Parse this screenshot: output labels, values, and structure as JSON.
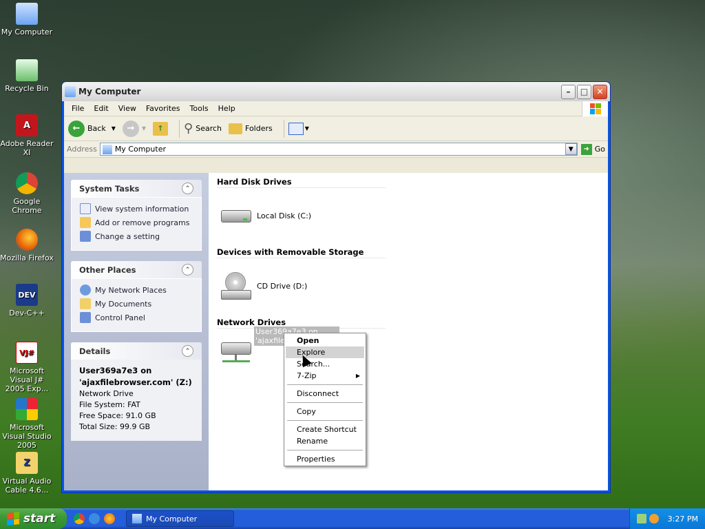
{
  "desktop": {
    "icons": [
      {
        "label": "My Computer"
      },
      {
        "label": "Recycle Bin"
      },
      {
        "label": "Adobe Reader XI"
      },
      {
        "label": "Google Chrome"
      },
      {
        "label": "Mozilla Firefox"
      },
      {
        "label": "Dev-C++",
        "glyph": "DEV"
      },
      {
        "label": "Microsoft Visual J# 2005 Exp...",
        "glyph": "VJ#"
      },
      {
        "label": "Microsoft Visual Studio 2005"
      },
      {
        "label": "Virtual Audio Cable 4.6...",
        "glyph": "Z"
      }
    ]
  },
  "window": {
    "title": "My Computer",
    "menu": [
      "File",
      "Edit",
      "View",
      "Favorites",
      "Tools",
      "Help"
    ],
    "toolbar": {
      "back": "Back",
      "search": "Search",
      "folders": "Folders"
    },
    "address": {
      "label": "Address",
      "value": "My Computer",
      "go": "Go"
    }
  },
  "left_pane": {
    "system_tasks": {
      "title": "System Tasks",
      "items": [
        "View system information",
        "Add or remove programs",
        "Change a setting"
      ]
    },
    "other_places": {
      "title": "Other Places",
      "items": [
        "My Network Places",
        "My Documents",
        "Control Panel"
      ]
    },
    "details": {
      "title": "Details",
      "name_line1": "User369a7e3 on",
      "name_line2": "'ajaxfilebrowser.com' (Z:)",
      "type": "Network Drive",
      "filesystem": "File System: FAT",
      "free": "Free Space: 91.0 GB",
      "total": "Total Size: 99.9 GB"
    }
  },
  "main": {
    "groups": [
      {
        "title": "Hard Disk Drives",
        "drive": "Local Disk (C:)"
      },
      {
        "title": "Devices with Removable Storage",
        "drive": "CD Drive (D:)"
      },
      {
        "title": "Network Drives",
        "drive_line1": "User369a7e3 on",
        "drive_line2": "'ajaxfileb"
      }
    ]
  },
  "context_menu": {
    "open": "Open",
    "explore": "Explore",
    "search": "Search...",
    "zip": "7-Zip",
    "disconnect": "Disconnect",
    "copy": "Copy",
    "create_shortcut": "Create Shortcut",
    "rename": "Rename",
    "properties": "Properties"
  },
  "taskbar": {
    "start": "start",
    "task": "My Computer",
    "time": "3:27 PM"
  }
}
